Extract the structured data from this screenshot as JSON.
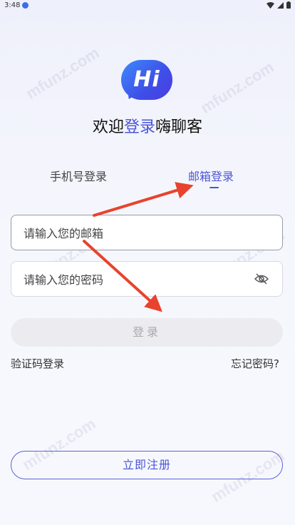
{
  "status_bar": {
    "time": "3:48"
  },
  "logo": {
    "text": "Hi"
  },
  "welcome": {
    "prefix": "欢迎",
    "accent": "登录",
    "suffix": "嗨聊客"
  },
  "tabs": [
    {
      "label": "手机号登录",
      "active": false
    },
    {
      "label": "邮箱登录",
      "active": true
    }
  ],
  "form": {
    "email_placeholder": "请输入您的邮箱",
    "password_placeholder": "请输入您的密码",
    "login_label": "登录"
  },
  "links": {
    "sms_login": "验证码登录",
    "forgot": "忘记密码?"
  },
  "register_label": "立即注册",
  "watermark": "mfunz.com",
  "colors": {
    "accent": "#4b55d8",
    "arrow": "#e8432e"
  },
  "icons": [
    "notification-icon",
    "wifi-icon",
    "signal-icon",
    "battery-icon",
    "eye-off-icon"
  ]
}
